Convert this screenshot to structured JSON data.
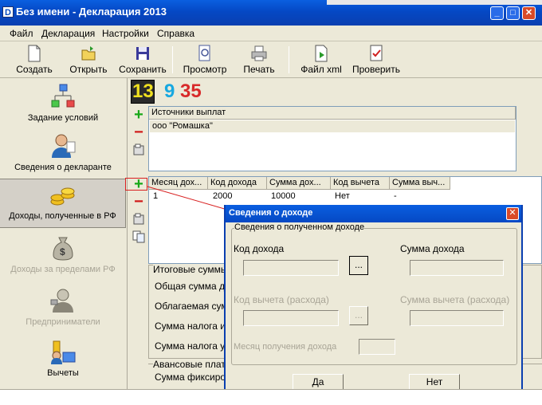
{
  "window": {
    "title": "Без имени - Декларация 2013",
    "app_icon": "D"
  },
  "menu": [
    "Файл",
    "Декларация",
    "Настройки",
    "Справка"
  ],
  "toolbar": {
    "create": "Создать",
    "open": "Открыть",
    "save": "Сохранить",
    "preview": "Просмотр",
    "print": "Печать",
    "xml": "Файл xml",
    "check": "Проверить"
  },
  "nav": {
    "conditions": "Задание условий",
    "declarant": "Сведения о декларанте",
    "income_rf": "Доходы, полученные в РФ",
    "income_abroad": "Доходы за пределами РФ",
    "entrepreneurs": "Предприниматели",
    "deductions": "Вычеты"
  },
  "rates": [
    "13",
    "9",
    "35"
  ],
  "sources": {
    "header": "Источники выплат",
    "rows": [
      "ооо \"Ромашка\""
    ]
  },
  "income_table": {
    "headers": [
      "Месяц дох...",
      "Код дохода",
      "Сумма дох...",
      "Код вычета",
      "Сумма выч..."
    ],
    "rows": [
      [
        "1",
        "2000",
        "10000",
        "Нет",
        "-"
      ]
    ]
  },
  "totals": {
    "group": "Итоговые суммы",
    "total_income": "Общая сумма дохода",
    "taxable": "Облагаемая сумма",
    "tax_calc": "Сумма налога исчисленная",
    "tax_withheld": "Сумма налога удержанная",
    "advance_group": "Авансовые платежи",
    "fixed": "Сумма фиксированных"
  },
  "dialog": {
    "title": "Сведения о доходе",
    "group": "Сведения о полученном доходе",
    "income_code": "Код дохода",
    "income_sum": "Сумма дохода",
    "deduction_code": "Код вычета (расхода)",
    "deduction_sum": "Сумма вычета (расхода)",
    "month": "Месяц получения дохода",
    "browse": "...",
    "ok": "Да",
    "cancel": "Нет"
  },
  "colors": {
    "titlebar": "#0548c4",
    "rate13": "#f0e020",
    "rate9": "#18a8e0",
    "rate35": "#d82a2a"
  }
}
